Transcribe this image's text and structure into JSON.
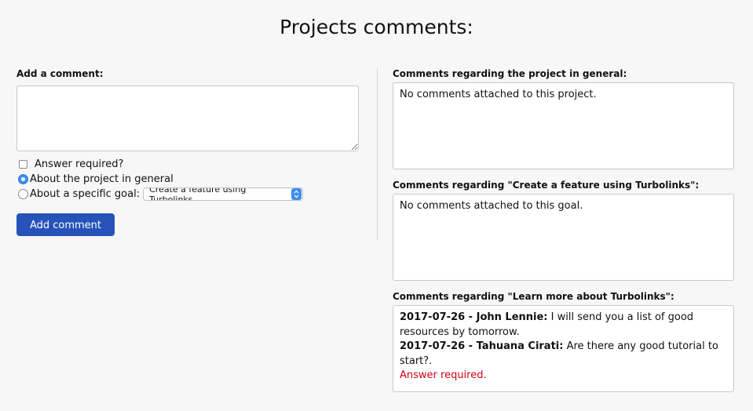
{
  "page": {
    "title": "Projects comments:"
  },
  "form": {
    "add_label": "Add a comment:",
    "textarea_value": "",
    "answer_required_label": "Answer required?",
    "radio_general_label": "About the project in general",
    "radio_goal_label": "About a specific goal:",
    "goal_select_value": "Create a feature using Turbolinks",
    "submit_label": "Add comment",
    "answer_required_checked": false,
    "selected_radio": "general"
  },
  "sections": [
    {
      "heading": "Comments regarding the project in general:",
      "empty_text": "No comments attached to this project."
    },
    {
      "heading": "Comments regarding \"Create a feature using Turbolinks\":",
      "empty_text": "No comments attached to this goal."
    },
    {
      "heading": "Comments regarding \"Learn more about Turbolinks\":",
      "comments": [
        {
          "meta": "2017-07-26 - John Lennie:",
          "text": "I will send you a list of good resources by tomorrow."
        },
        {
          "meta": "2017-07-26 - Tahuana Cirati:",
          "text": "Are there any good tutorial to start?.",
          "note": "Answer required."
        }
      ]
    }
  ],
  "colors": {
    "primary_button": "#2753b8",
    "radio_accent": "#3d8fef",
    "required_text": "#d0021b"
  }
}
